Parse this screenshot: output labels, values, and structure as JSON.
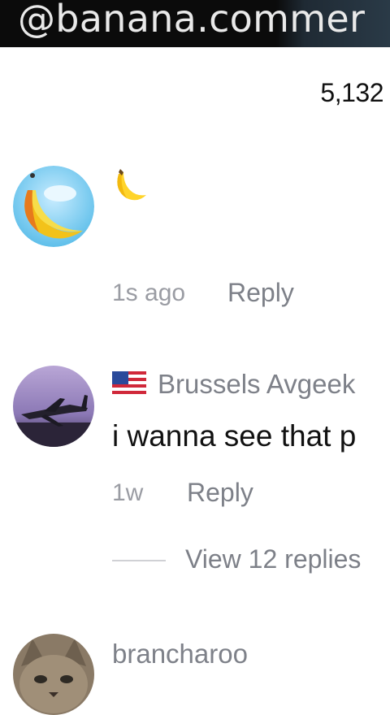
{
  "watermark": {
    "text": "@banana.commer"
  },
  "comments_count": "5,132",
  "comments": [
    {
      "avatar": "banana-globe-icon",
      "username": "",
      "text": "🍌",
      "time": "1s ago",
      "reply_label": "Reply"
    },
    {
      "avatar": "airplane-photo",
      "flag": "us-flag-icon",
      "username": "Brussels Avgeek",
      "text": "i wanna see that p",
      "time": "1w",
      "reply_label": "Reply",
      "view_replies": "View 12 replies"
    },
    {
      "avatar": "cat-photo",
      "username": "brancharoo",
      "text": "",
      "time": "",
      "reply_label": ""
    }
  ],
  "colors": {
    "top_bar": "#0b0b0b",
    "text_primary": "#161823",
    "text_secondary": "#7d8088"
  }
}
